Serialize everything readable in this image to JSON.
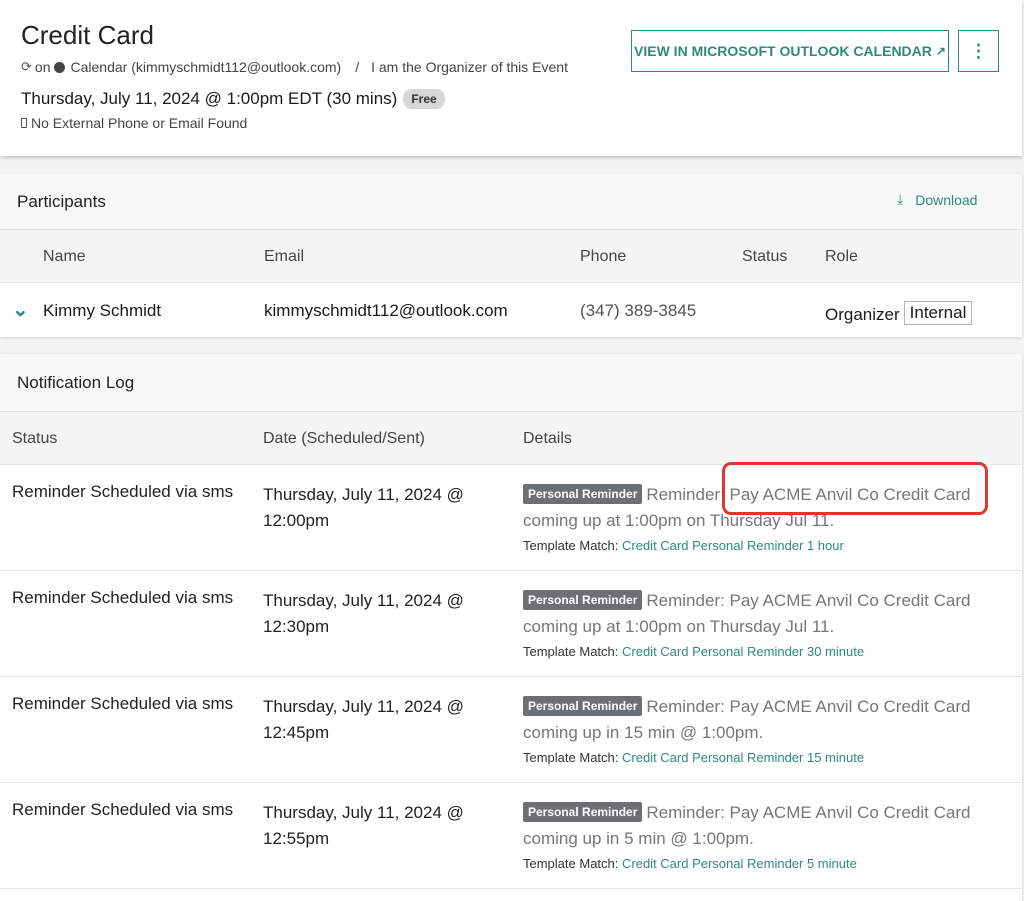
{
  "event": {
    "title": "Credit Card",
    "sync_on": "on",
    "calendar": "Calendar (kimmyschmidt112@outlook.com)",
    "separator": "/",
    "organizer_note": "I am the Organizer of this Event",
    "datetime": "Thursday, July 11, 2024 @ 1:00pm EDT (30 mins)",
    "availability": "Free",
    "phone_note": "No External Phone or Email Found",
    "view_button": "VIEW IN MICROSOFT OUTLOOK CALENDAR",
    "more_button": "⋮"
  },
  "participants": {
    "heading": "Participants",
    "download": "Download",
    "columns": [
      "Name",
      "Email",
      "Phone",
      "Status",
      "Role"
    ],
    "rows": [
      {
        "name": "Kimmy Schmidt",
        "email": "kimmyschmidt112@outlook.com",
        "phone": "(347) 389-3845",
        "status": "",
        "role": "Organizer",
        "badge": "Internal"
      }
    ]
  },
  "notifications": {
    "heading": "Notification Log",
    "columns": [
      "Status",
      "Date (Scheduled/Sent)",
      "Details"
    ],
    "template_prefix": "Template Match:",
    "badge": "Personal Reminder",
    "rows": [
      {
        "status": "Reminder Scheduled via sms",
        "date": "Thursday, July 11, 2024 @ 12:00pm",
        "message": "Reminder: Pay ACME Anvil Co Credit Card coming up at 1:00pm on Thursday Jul 11.",
        "template": "Credit Card Personal Reminder 1 hour"
      },
      {
        "status": "Reminder Scheduled via sms",
        "date": "Thursday, July 11, 2024 @ 12:30pm",
        "message": "Reminder: Pay ACME Anvil Co Credit Card coming up at 1:00pm on Thursday Jul 11.",
        "template": "Credit Card Personal Reminder 30 minute"
      },
      {
        "status": "Reminder Scheduled via sms",
        "date": "Thursday, July 11, 2024 @ 12:45pm",
        "message": "Reminder: Pay ACME Anvil Co Credit Card coming up in 15 min @ 1:00pm.",
        "template": "Credit Card Personal Reminder 15 minute"
      },
      {
        "status": "Reminder Scheduled via sms",
        "date": "Thursday, July 11, 2024 @ 12:55pm",
        "message": "Reminder: Pay ACME Anvil Co Credit Card coming up in 5 min @ 1:00pm.",
        "template": "Credit Card Personal Reminder 5 minute"
      }
    ]
  },
  "colors": {
    "accent": "#2e8b7a",
    "highlight": "#d93a2b",
    "badge": "#6c7073"
  },
  "icons": {
    "sync": "sync-icon",
    "calendar_dot": "calendar-dot-icon",
    "phone": "phone-icon",
    "external": "external-link-icon",
    "download": "download-icon",
    "chevron": "chevron-down-icon"
  }
}
